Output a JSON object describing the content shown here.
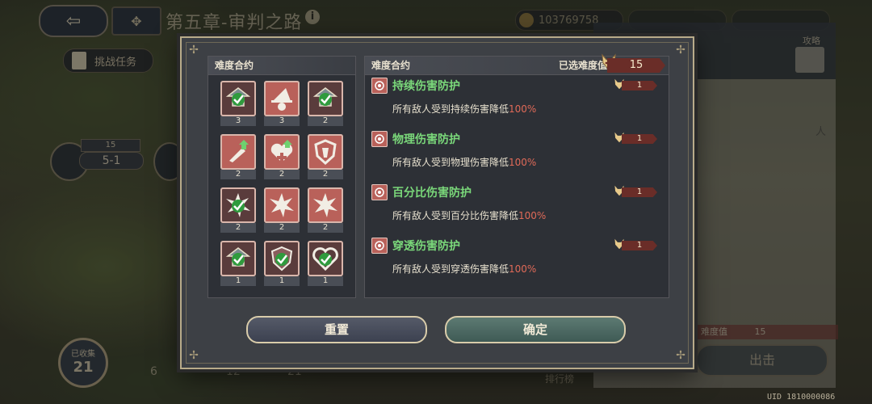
{
  "background": {
    "chapter_title": "第五章-审判之路",
    "gold": "103769758",
    "challenge_task": "挑战任务",
    "stage_stars": "15",
    "stage_label": "5-1",
    "collected_label": "已收集",
    "collected_value": "21",
    "bottom_nums": [
      "6",
      "12",
      "21"
    ],
    "rank_tab": "排行榜",
    "guide_label": "攻略",
    "side_enemy_text": "人",
    "side_diff_label": "难度值",
    "side_diff_value": "15",
    "fight_label": "出击",
    "uid": "UID 1810000086"
  },
  "dialog": {
    "left_title": "难度合约",
    "right_title": "难度合约",
    "selected_label": "已选难度值",
    "selected_value": "15",
    "contracts": [
      {
        "icon": "arrow-down-shield-icon",
        "count": "3",
        "selected": true
      },
      {
        "icon": "witch-hat-icon",
        "count": "3",
        "selected": false
      },
      {
        "icon": "arrow-down-shield-icon",
        "count": "2",
        "selected": true
      },
      {
        "icon": "sword-up-icon",
        "count": "2",
        "selected": false
      },
      {
        "icon": "heart-plus-up-icon",
        "count": "2",
        "selected": false
      },
      {
        "icon": "shield-crest-icon",
        "count": "2",
        "selected": false
      },
      {
        "icon": "burst-icon",
        "count": "2",
        "selected": true
      },
      {
        "icon": "burst-icon",
        "count": "2",
        "selected": false
      },
      {
        "icon": "burst-icon",
        "count": "2",
        "selected": false
      },
      {
        "icon": "arrow-down-shield-icon",
        "count": "1",
        "selected": true
      },
      {
        "icon": "shield-ban-icon",
        "count": "1",
        "selected": true
      },
      {
        "icon": "heart-icon",
        "count": "1",
        "selected": true
      }
    ],
    "effects": [
      {
        "name": "持续伤害防护",
        "tag": "1",
        "desc": "所有敌人受到持续伤害降低",
        "pct": "100%"
      },
      {
        "name": "物理伤害防护",
        "tag": "1",
        "desc": "所有敌人受到物理伤害降低",
        "pct": "100%"
      },
      {
        "name": "百分比伤害防护",
        "tag": "1",
        "desc": "所有敌人受到百分比伤害降低",
        "pct": "100%"
      },
      {
        "name": "穿透伤害防护",
        "tag": "1",
        "desc": "所有敌人受到穿透伤害降低",
        "pct": "100%"
      }
    ],
    "reset_label": "重置",
    "confirm_label": "确定"
  },
  "colors": {
    "accent_red": "#b9615a",
    "effect_green": "#7ad87a",
    "percent_red": "#e06a58"
  }
}
